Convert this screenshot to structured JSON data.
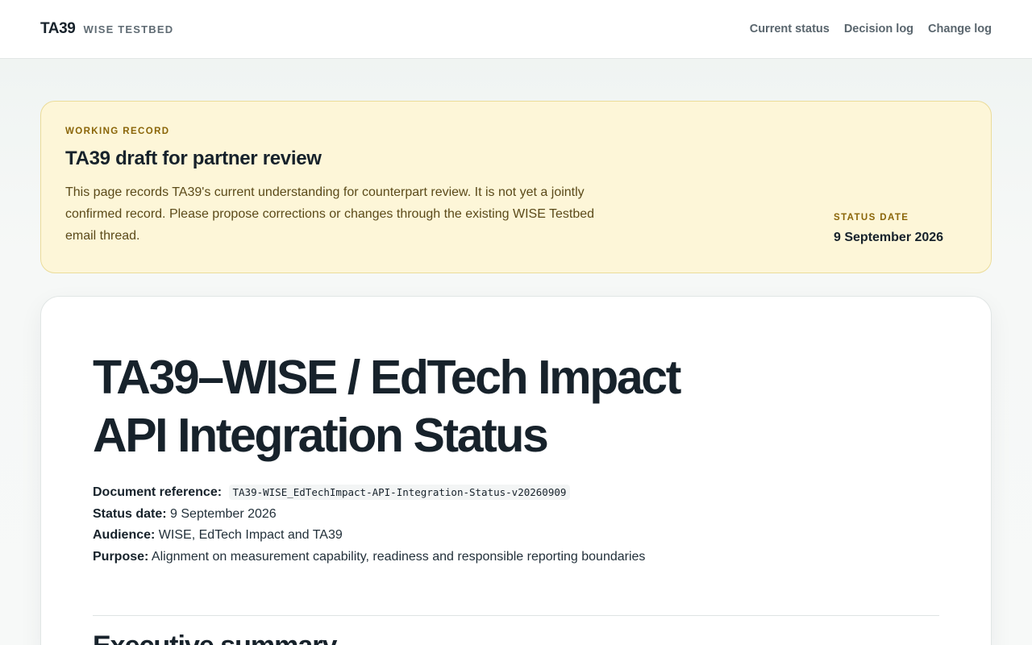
{
  "header": {
    "logo": "TA39",
    "subtitle": "WISE TESTBED",
    "nav": [
      "Current status",
      "Decision log",
      "Change log"
    ]
  },
  "notice": {
    "eyebrow": "WORKING RECORD",
    "title": "TA39 draft for partner review",
    "body": "This page records TA39's current understanding for counterpart review. It is not yet a jointly confirmed record. Please propose corrections or changes through the existing WISE Testbed email thread.",
    "status_label": "STATUS DATE",
    "status_value": "9 September 2026"
  },
  "document": {
    "title": "TA39–WISE / EdTech Impact API Integration Status",
    "meta": {
      "reference_label": "Document reference:",
      "reference_value": "TA39-WISE_EdTechImpact-API-Integration-Status-v20260909",
      "status_label": "Status date:",
      "status_value": "9 September 2026",
      "audience_label": "Audience:",
      "audience_value": "WISE, EdTech Impact and TA39",
      "purpose_label": "Purpose:",
      "purpose_value": "Alignment on measurement capability, readiness and responsible reporting boundaries"
    },
    "section_heading": "Executive summary"
  },
  "colors": {
    "notice_bg": "#fdf6d8",
    "notice_border": "#ebdc9a",
    "eyebrow": "#8a6508",
    "text_dark": "#17222b",
    "nav_text": "#59656d"
  }
}
